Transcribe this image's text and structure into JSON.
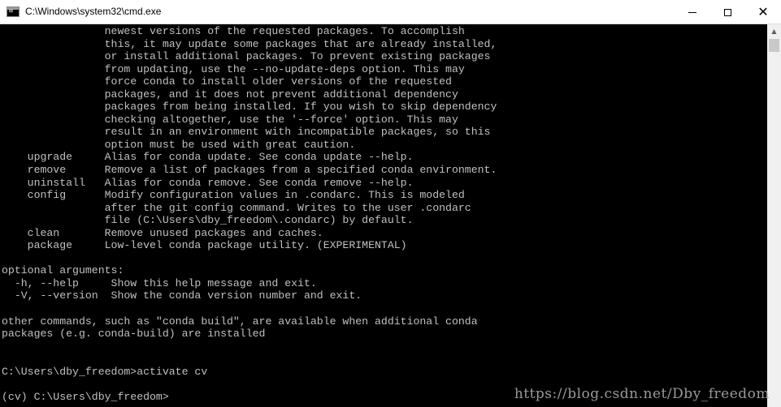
{
  "window": {
    "title": "C:\\Windows\\system32\\cmd.exe",
    "minimize_glyph": "",
    "close_glyph": "✕"
  },
  "console": {
    "lines": [
      "                newest versions of the requested packages. To accomplish",
      "                this, it may update some packages that are already installed,",
      "                or install additional packages. To prevent existing packages",
      "                from updating, use the --no-update-deps option. This may",
      "                force conda to install older versions of the requested",
      "                packages, and it does not prevent additional dependency",
      "                packages from being installed. If you wish to skip dependency",
      "                checking altogether, use the '--force' option. This may",
      "                result in an environment with incompatible packages, so this",
      "                option must be used with great caution.",
      "    upgrade     Alias for conda update. See conda update --help.",
      "    remove      Remove a list of packages from a specified conda environment.",
      "    uninstall   Alias for conda remove. See conda remove --help.",
      "    config      Modify configuration values in .condarc. This is modeled",
      "                after the git config command. Writes to the user .condarc",
      "                file (C:\\Users\\dby_freedom\\.condarc) by default.",
      "    clean       Remove unused packages and caches.",
      "    package     Low-level conda package utility. (EXPERIMENTAL)",
      "",
      "optional arguments:",
      "  -h, --help     Show this help message and exit.",
      "  -V, --version  Show the conda version number and exit.",
      "",
      "other commands, such as \"conda build\", are available when additional conda",
      "packages (e.g. conda-build) are installed",
      "",
      "",
      "C:\\Users\\dby_freedom>activate cv",
      "",
      "(cv) C:\\Users\\dby_freedom>"
    ]
  },
  "watermark": "https://blog.csdn.net/Dby_freedom"
}
